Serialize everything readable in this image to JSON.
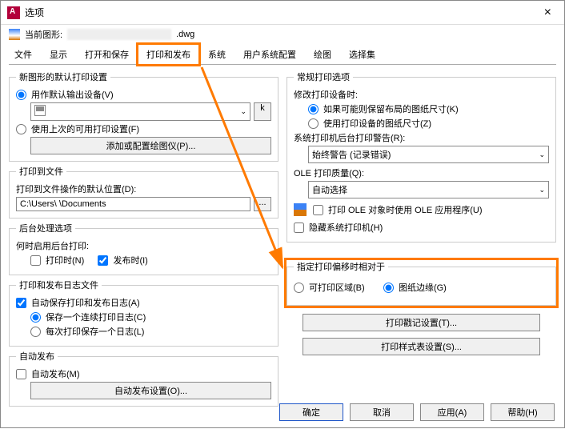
{
  "window": {
    "title": "选项"
  },
  "current": {
    "label": "当前图形:",
    "ext": ".dwg"
  },
  "tabs": [
    "文件",
    "显示",
    "打开和保存",
    "打印和发布",
    "系统",
    "用户系统配置",
    "绘图",
    "选择集"
  ],
  "active_tab_index": 3,
  "left": {
    "grp1": {
      "legend": "新图形的默认打印设置",
      "r1": "用作默认输出设备(V)",
      "r2": "使用上次的可用打印设置(F)",
      "btn": "添加或配置绘图仪(P)..."
    },
    "grp2": {
      "legend": "打印到文件",
      "label": "打印到文件操作的默认位置(D):",
      "path": "C:\\Users\\          \\Documents"
    },
    "grp3": {
      "legend": "后台处理选项",
      "label": "何时启用后台打印:",
      "c1": "打印时(N)",
      "c2": "发布时(I)"
    },
    "grp4": {
      "legend": "打印和发布日志文件",
      "c1": "自动保存打印和发布日志(A)",
      "r1": "保存一个连续打印日志(C)",
      "r2": "每次打印保存一个日志(L)"
    },
    "grp5": {
      "legend": "自动发布",
      "c1": "自动发布(M)",
      "btn": "自动发布设置(O)..."
    }
  },
  "right": {
    "grp1": {
      "legend": "常规打印选项",
      "label1": "修改打印设备时:",
      "r1": "如果可能则保留布局的图纸尺寸(K)",
      "r2": "使用打印设备的图纸尺寸(Z)",
      "label2": "系统打印机后台打印警告(R):",
      "dd1": "始终警告 (记录错误)",
      "label3": "OLE 打印质量(Q):",
      "dd2": "自动选择",
      "c1": "打印 OLE 对象时使用 OLE 应用程序(U)",
      "c2": "隐藏系统打印机(H)"
    },
    "grp2": {
      "legend": "指定打印偏移时相对于",
      "r1": "可打印区域(B)",
      "r2": "图纸边缘(G)"
    },
    "btn1": "打印戳记设置(T)...",
    "btn2": "打印样式表设置(S)..."
  },
  "footer": {
    "ok": "确定",
    "cancel": "取消",
    "apply": "应用(A)",
    "help": "帮助(H)"
  }
}
